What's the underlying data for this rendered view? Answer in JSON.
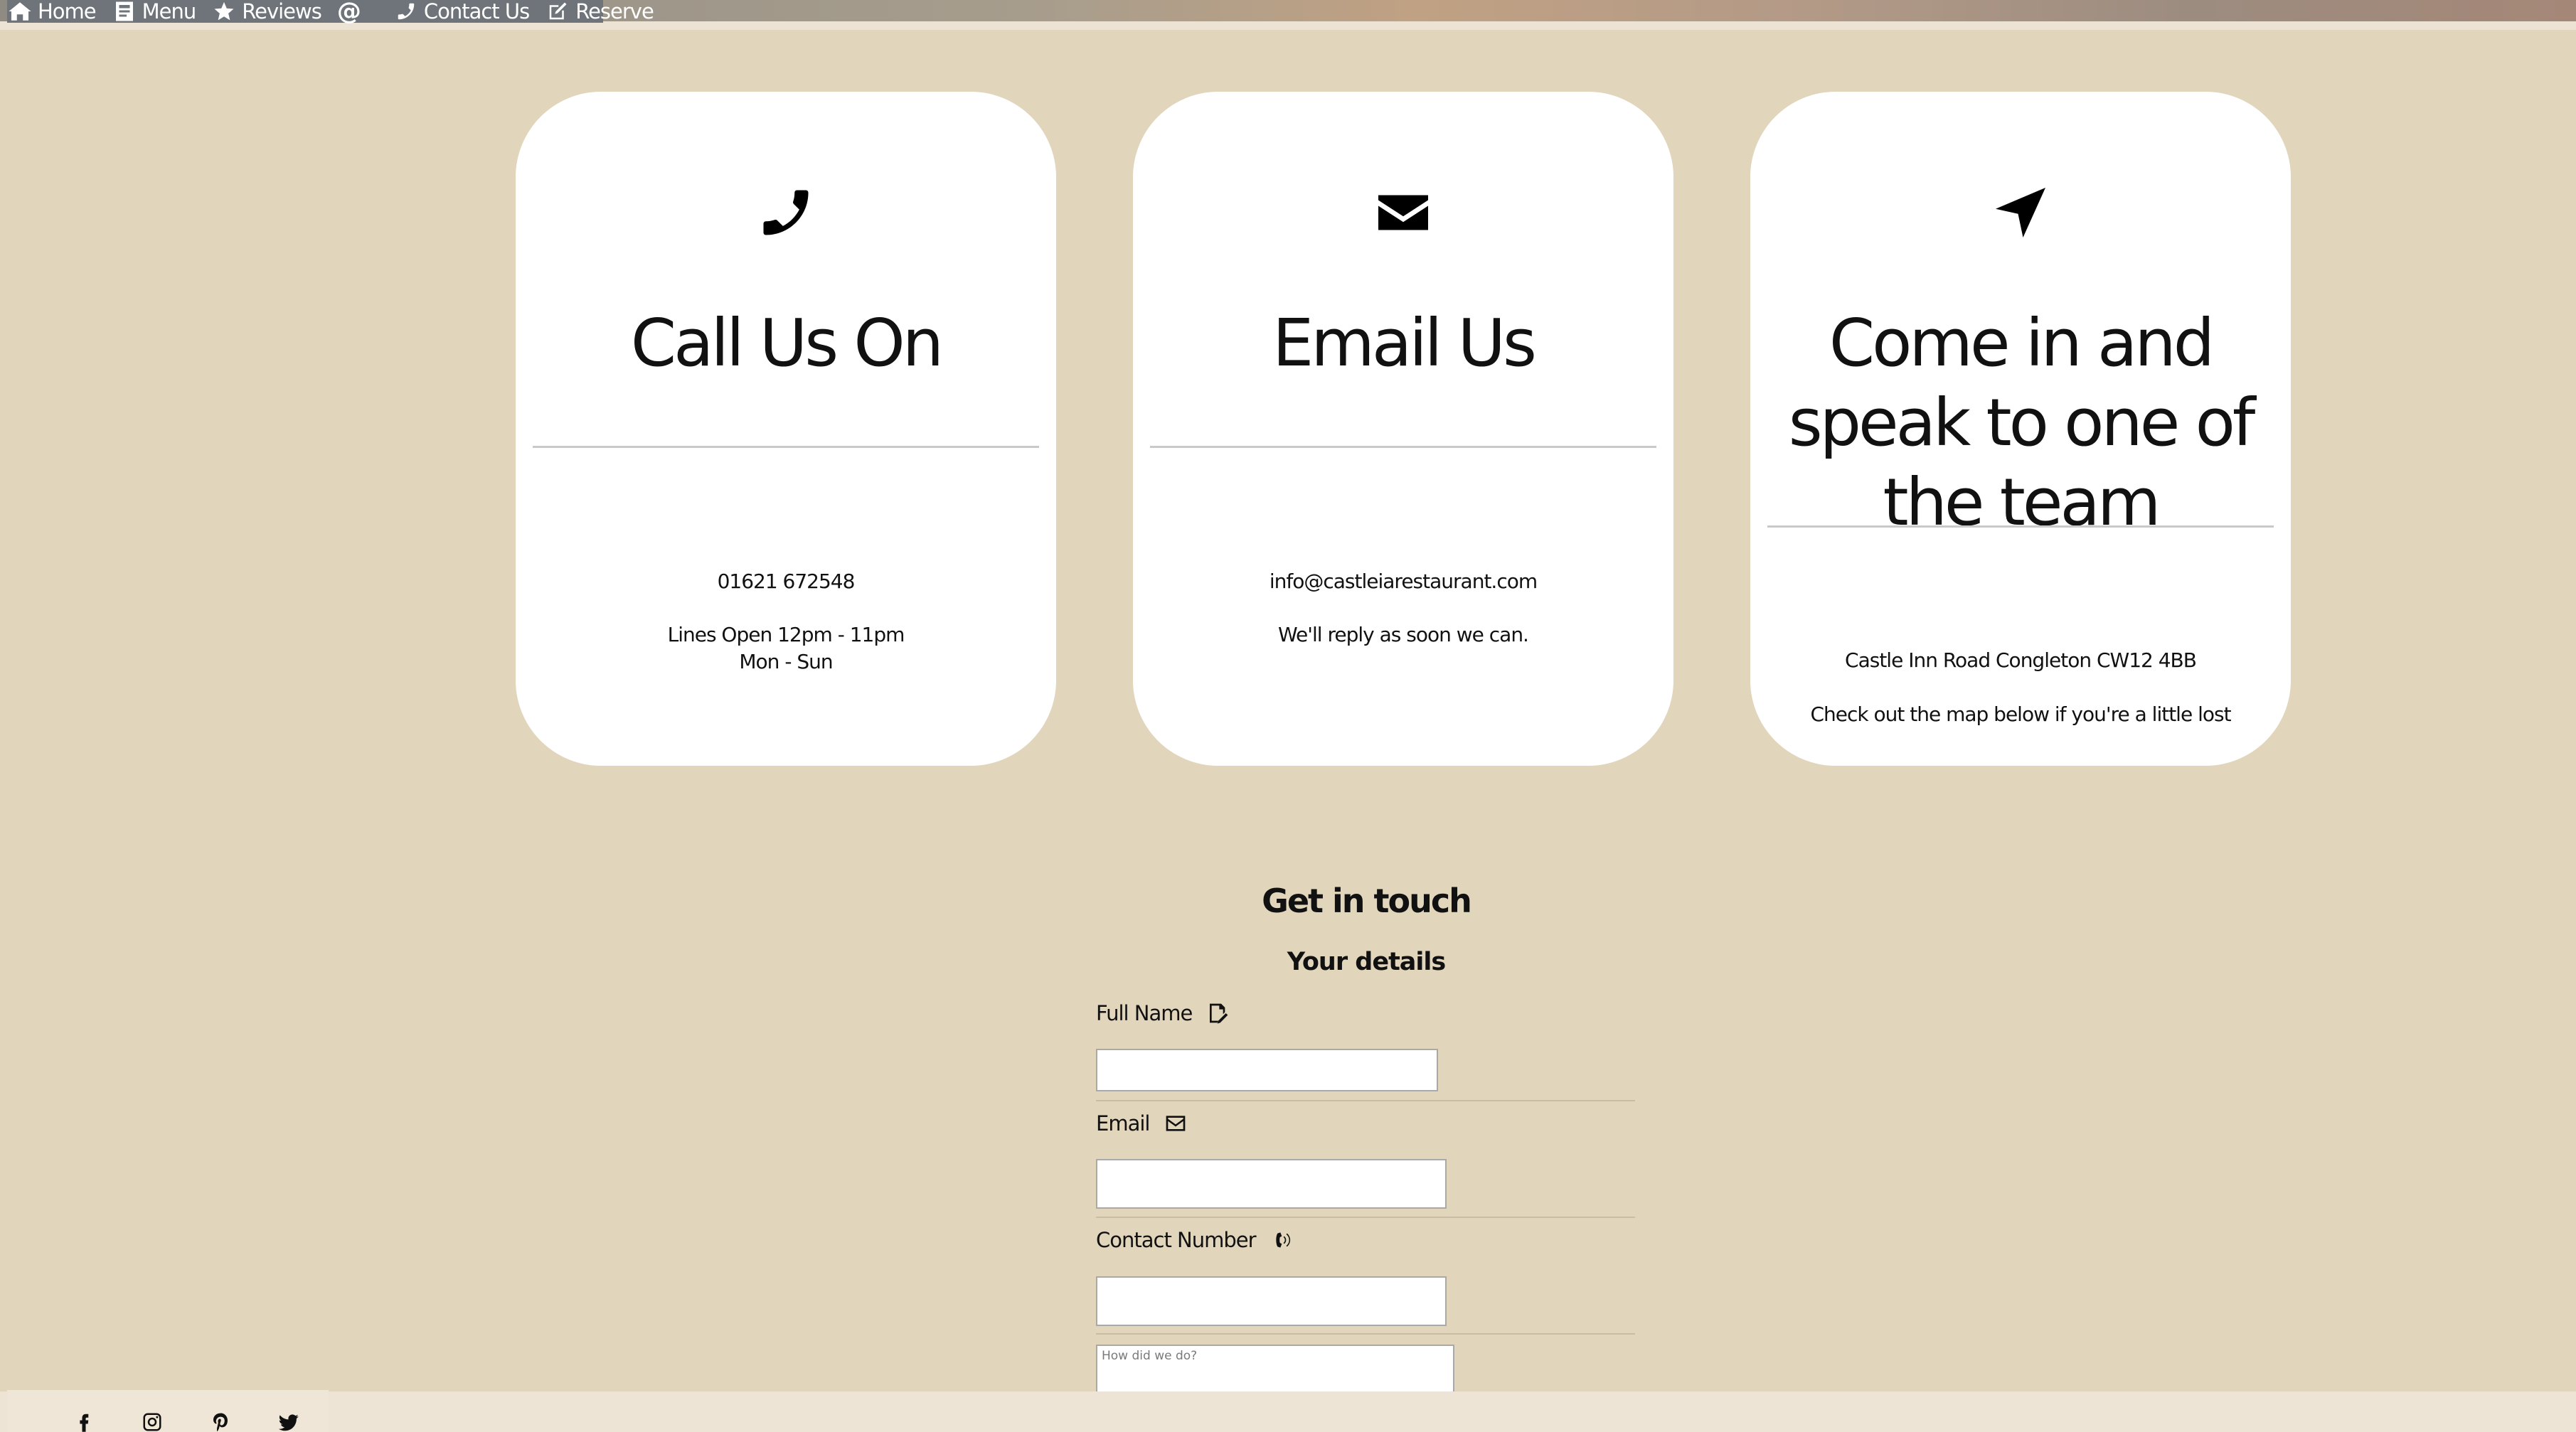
{
  "nav": {
    "items": [
      {
        "label": "Home",
        "icon": "home-icon"
      },
      {
        "label": "Menu",
        "icon": "menu-book-icon"
      },
      {
        "label": "Reviews",
        "icon": "star-icon"
      },
      {
        "label": "",
        "icon": "at-sign-icon",
        "glyph": "@"
      },
      {
        "label": "Contact Us",
        "icon": "phone-icon"
      },
      {
        "label": "Reserve",
        "icon": "edit-icon"
      }
    ]
  },
  "cards": [
    {
      "icon": "phone-icon",
      "title": "Call Us On",
      "line1": "01621 672548",
      "line2": "Lines Open 12pm - 11pm",
      "line3": "Mon - Sun"
    },
    {
      "icon": "envelope-icon",
      "title": "Email Us",
      "line1": "info@castleiarestaurant.com",
      "line2": "We'll reply as soon we can."
    },
    {
      "icon": "location-arrow-icon",
      "title": "Come in and speak to one of the team",
      "line1": "Castle Inn Road Congleton CW12 4BB",
      "line2": "Check out the map below if you're a little lost"
    }
  ],
  "form": {
    "heading": "Get in touch",
    "subheading": "Your details",
    "full_name_label": "Full Name",
    "email_label": "Email",
    "contact_label": "Contact Number",
    "feedback_placeholder": "How did we do?"
  },
  "footer": {
    "social": [
      "facebook-icon",
      "instagram-icon",
      "pinterest-icon",
      "twitter-icon"
    ]
  },
  "colors": {
    "background": "#e1d5bc",
    "card": "#ffffff",
    "nav": "#6e7479"
  }
}
